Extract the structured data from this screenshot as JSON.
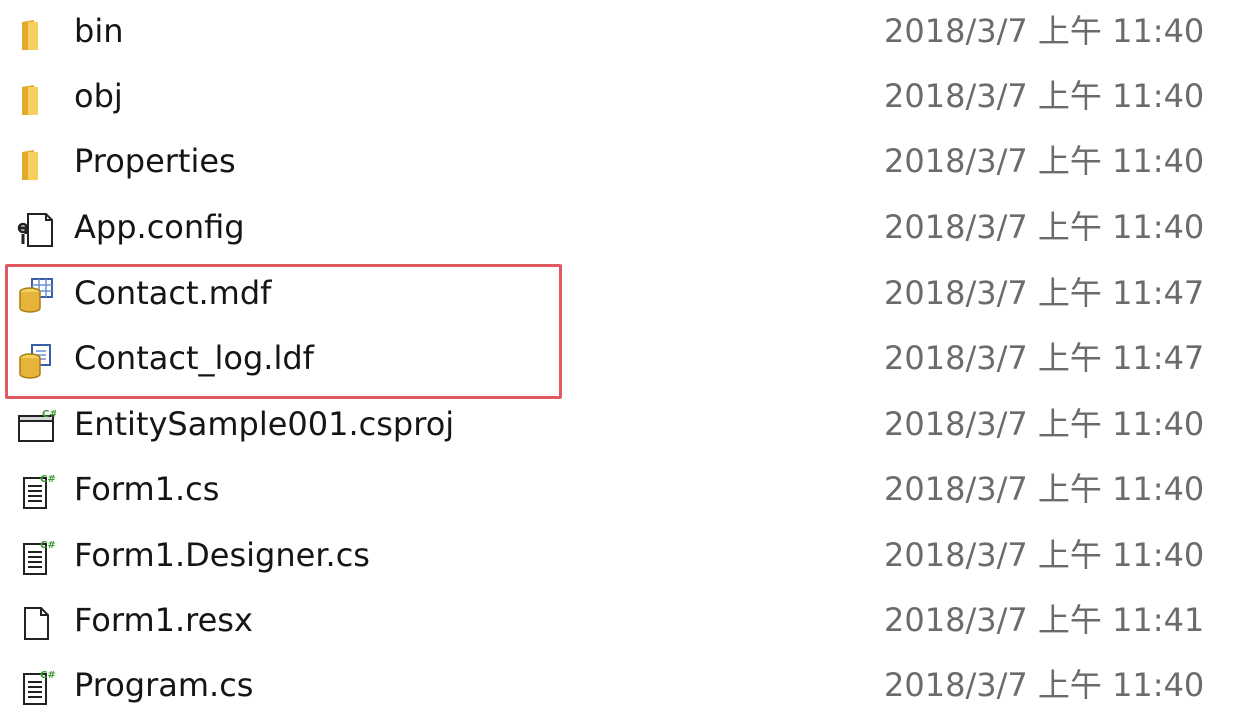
{
  "files": [
    {
      "name": "bin",
      "date": "2018/3/7 上午 11:40",
      "icon": "folder-icon"
    },
    {
      "name": "obj",
      "date": "2018/3/7 上午 11:40",
      "icon": "folder-icon"
    },
    {
      "name": "Properties",
      "date": "2018/3/7 上午 11:40",
      "icon": "folder-icon"
    },
    {
      "name": "App.config",
      "date": "2018/3/7 上午 11:40",
      "icon": "config-file-icon"
    },
    {
      "name": "Contact.mdf",
      "date": "2018/3/7 上午 11:47",
      "icon": "database-file-icon"
    },
    {
      "name": "Contact_log.ldf",
      "date": "2018/3/7 上午 11:47",
      "icon": "database-log-icon"
    },
    {
      "name": "EntitySample001.csproj",
      "date": "2018/3/7 上午 11:40",
      "icon": "csproj-icon"
    },
    {
      "name": "Form1.cs",
      "date": "2018/3/7 上午 11:40",
      "icon": "csharp-file-icon"
    },
    {
      "name": "Form1.Designer.cs",
      "date": "2018/3/7 上午 11:40",
      "icon": "csharp-file-icon"
    },
    {
      "name": "Form1.resx",
      "date": "2018/3/7 上午 11:41",
      "icon": "generic-file-icon"
    },
    {
      "name": "Program.cs",
      "date": "2018/3/7 上午 11:40",
      "icon": "csharp-file-icon"
    }
  ],
  "highlight": {
    "color": "#e05a5f"
  },
  "colors": {
    "folder": "#f2c14e",
    "csharp": "#3f9c35",
    "date_text": "#6b6b6b"
  }
}
